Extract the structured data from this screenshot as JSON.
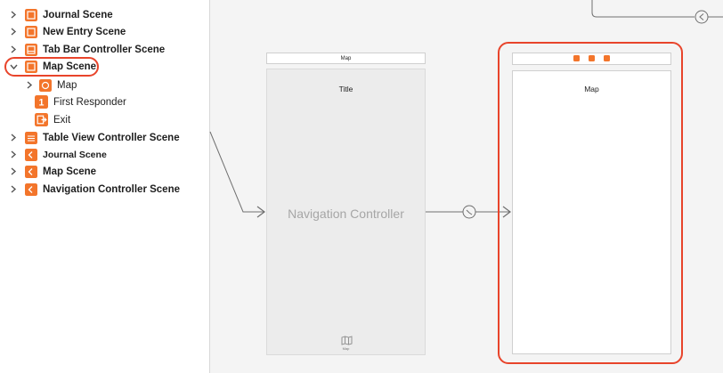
{
  "outline": {
    "items": [
      {
        "label": "Journal Scene",
        "expanded": false
      },
      {
        "label": "New Entry Scene",
        "expanded": false
      },
      {
        "label": "Tab Bar Controller Scene",
        "expanded": false
      },
      {
        "label": "Map Scene",
        "expanded": true,
        "selected": true
      },
      {
        "label": "Map",
        "expanded": false
      },
      {
        "label": "First Responder",
        "icon_text": "1"
      },
      {
        "label": "Exit"
      },
      {
        "label": "Table View Controller Scene",
        "expanded": false
      },
      {
        "label": "Journal Scene",
        "expanded": false
      },
      {
        "label": "Map Scene",
        "expanded": false
      },
      {
        "label": "Navigation Controller Scene",
        "expanded": false
      }
    ]
  },
  "canvas": {
    "nav_controller": {
      "title_bar": "Map",
      "nav_title": "Title",
      "name": "Navigation Controller",
      "tab_label": "Map"
    },
    "map_controller": {
      "title": "Map"
    }
  },
  "colors": {
    "accent_orange": "#f3752b",
    "highlight_red": "#e8442b"
  }
}
